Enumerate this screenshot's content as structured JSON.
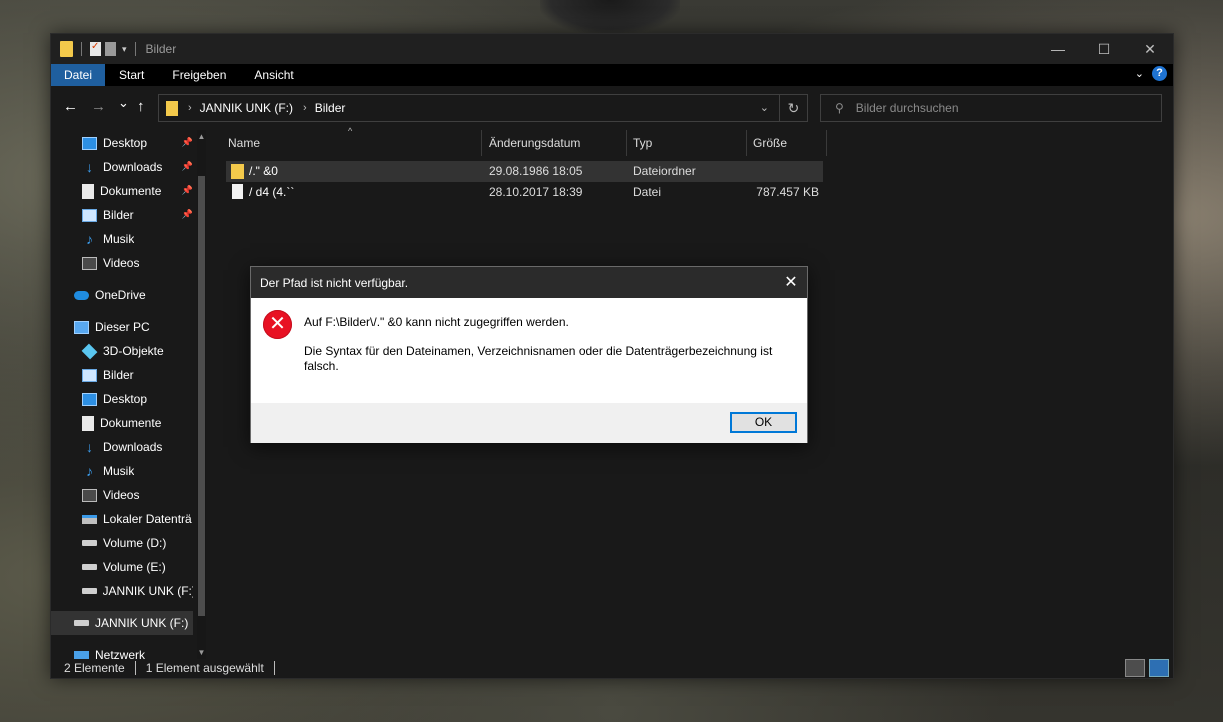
{
  "window": {
    "title": "Bilder",
    "controls": {
      "minimize": "—",
      "maximize": "☐",
      "close": "✕"
    }
  },
  "ribbon": {
    "tabs": [
      "Datei",
      "Start",
      "Freigeben",
      "Ansicht"
    ],
    "active_tab": "Datei",
    "help_label": "?"
  },
  "nav": {
    "back": "←",
    "forward": "→",
    "recent": "⌄",
    "up": "↑",
    "breadcrumb": [
      "JANNIK UNK (F:)",
      "Bilder"
    ],
    "search_placeholder": "Bilder durchsuchen"
  },
  "sidebar": {
    "items": [
      {
        "label": "Desktop",
        "icon": "desktop-icon",
        "pinned": true
      },
      {
        "label": "Downloads",
        "icon": "download-icon",
        "pinned": true
      },
      {
        "label": "Dokumente",
        "icon": "document-icon",
        "pinned": true
      },
      {
        "label": "Bilder",
        "icon": "pictures-icon",
        "pinned": true
      },
      {
        "label": "Musik",
        "icon": "music-icon",
        "pinned": false
      },
      {
        "label": "Videos",
        "icon": "video-icon",
        "pinned": false
      },
      {
        "label": "OneDrive",
        "icon": "onedrive-icon",
        "pinned": false
      },
      {
        "label": "Dieser PC",
        "icon": "pc-icon",
        "pinned": false
      },
      {
        "label": "3D-Objekte",
        "icon": "3d-objects-icon",
        "pinned": false
      },
      {
        "label": "Bilder",
        "icon": "pictures-icon",
        "pinned": false
      },
      {
        "label": "Desktop",
        "icon": "desktop-icon",
        "pinned": false
      },
      {
        "label": "Dokumente",
        "icon": "document-icon",
        "pinned": false
      },
      {
        "label": "Downloads",
        "icon": "download-icon",
        "pinned": false
      },
      {
        "label": "Musik",
        "icon": "music-icon",
        "pinned": false
      },
      {
        "label": "Videos",
        "icon": "video-icon",
        "pinned": false
      },
      {
        "label": "Lokaler Datenträ",
        "icon": "local-disk-icon",
        "pinned": false
      },
      {
        "label": "Volume (D:)",
        "icon": "drive-icon",
        "pinned": false
      },
      {
        "label": "Volume (E:)",
        "icon": "drive-icon",
        "pinned": false
      },
      {
        "label": "JANNIK UNK (F:)",
        "icon": "drive-icon",
        "pinned": false
      },
      {
        "label": "JANNIK UNK (F:)",
        "icon": "drive-icon",
        "pinned": false
      },
      {
        "label": "Netzwerk",
        "icon": "network-icon",
        "pinned": false
      }
    ]
  },
  "files": {
    "columns": {
      "name": "Name",
      "date": "Änderungsdatum",
      "type": "Typ",
      "size": "Größe"
    },
    "rows": [
      {
        "name": "/.\" &0",
        "date": "29.08.1986 18:05",
        "type": "Dateiordner",
        "size": "",
        "kind": "folder"
      },
      {
        "name": "/ d4  (4.``",
        "date": "28.10.2017 18:39",
        "type": "Datei",
        "size": "787.457 KB",
        "kind": "file"
      }
    ]
  },
  "status": {
    "count": "2 Elemente",
    "selected": "1 Element ausgewählt"
  },
  "dialog": {
    "title": "Der Pfad ist nicht verfügbar.",
    "message": "Auf F:\\Bilder\\/.\" &0 kann nicht zugegriffen werden.",
    "detail": "Die Syntax für den Dateinamen, Verzeichnisnamen oder die Datenträgerbezeichnung ist falsch.",
    "ok_label": "OK",
    "close": "✕",
    "error_glyph": "✕"
  },
  "colors": {
    "accent": "#0078d7",
    "active_tab": "#1f5f9f",
    "folder": "#f3c94b",
    "error": "#e81123"
  }
}
